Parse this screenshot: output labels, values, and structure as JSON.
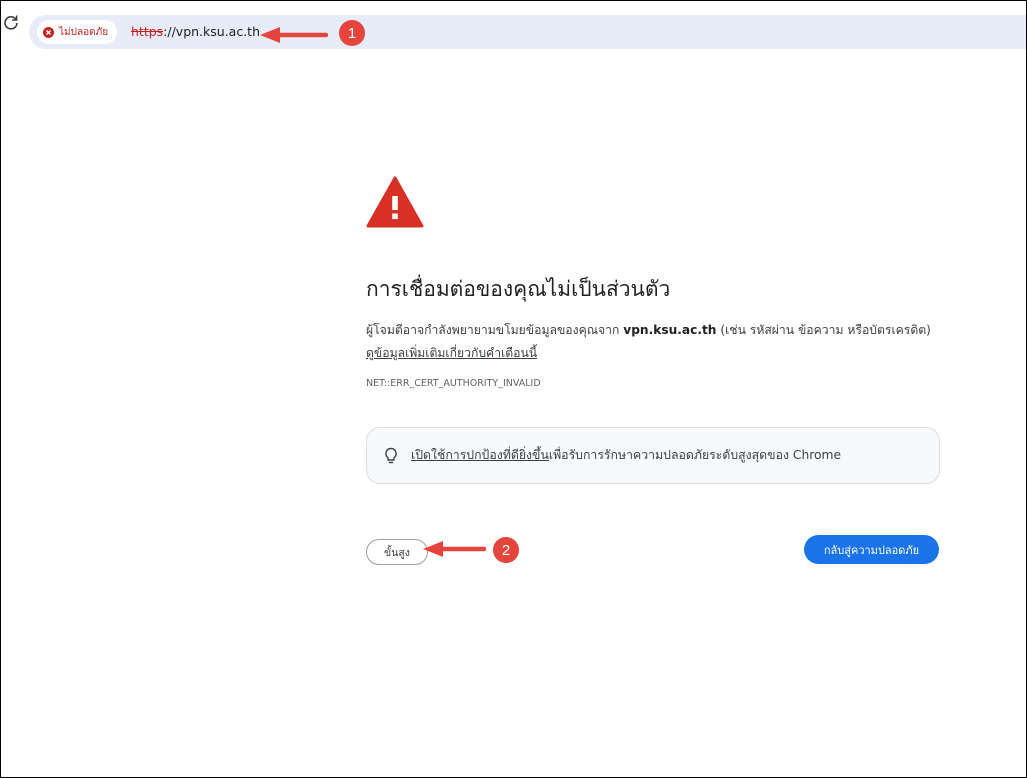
{
  "browser": {
    "security_chip_label": "ไม่ปลอดภัย",
    "url_scheme": "https",
    "url_rest": "://vpn.ksu.ac.th",
    "accent_red": "#c5221f"
  },
  "annotations": {
    "marker_1": "1",
    "marker_2": "2",
    "color": "#e4443b"
  },
  "interstitial": {
    "icon": "warning-triangle-icon",
    "title": "การเชื่อมต่อของคุณไม่เป็นส่วนตัว",
    "desc_prefix": "ผู้โจมตีอาจกำลังพยายามขโมยข้อมูลของคุณจาก ",
    "desc_host": "vpn.ksu.ac.th",
    "desc_suffix": " (เช่น รหัสผ่าน ข้อความ หรือบัตรเครดิต) ",
    "desc_link": "ดูข้อมูลเพิ่มเติมเกี่ยวกับคำเตือนนี้",
    "error_code": "NET::ERR_CERT_AUTHORITY_INVALID",
    "protection_link": "เปิดใช้การปกป้องที่ดียิ่งขึ้น",
    "protection_text": "เพื่อรับการรักษาความปลอดภัยระดับสูงสุดของ Chrome",
    "advanced_button": "ขั้นสูง",
    "back_button": "กลับสู่ความปลอดภัย",
    "primary_color": "#1a73e8",
    "warning_color": "#d93025"
  }
}
